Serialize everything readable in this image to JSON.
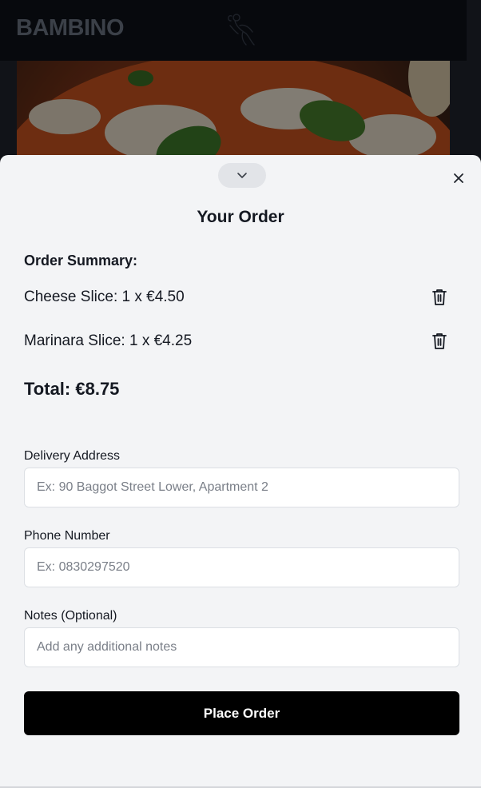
{
  "header": {
    "brand": "BAMBINO",
    "logo_icon": "cherub-logo-icon"
  },
  "sheet": {
    "collapse_icon": "chevron-down-icon",
    "close_icon": "close-icon",
    "title": "Your Order",
    "summary_label": "Order Summary:",
    "items": [
      {
        "text": "Cheese Slice: 1 x €4.50",
        "remove_icon": "trash-icon"
      },
      {
        "text": "Marinara Slice: 1 x €4.25",
        "remove_icon": "trash-icon"
      }
    ],
    "total": "Total: €8.75"
  },
  "form": {
    "address": {
      "label": "Delivery Address",
      "value": "",
      "placeholder": "Ex: 90 Baggot Street Lower, Apartment 2"
    },
    "phone": {
      "label": "Phone Number",
      "value": "",
      "placeholder": "Ex: 0830297520"
    },
    "notes": {
      "label": "Notes (Optional)",
      "value": "",
      "placeholder": "Add any additional notes"
    },
    "submit_label": "Place Order"
  },
  "colors": {
    "sheet_background": "#f3f4f6",
    "primary_button": "#000000",
    "header_background": "#07090d"
  }
}
